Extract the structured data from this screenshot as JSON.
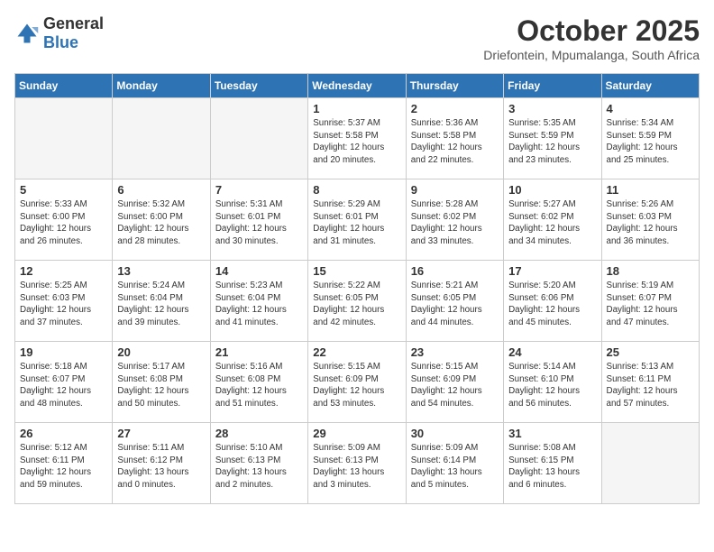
{
  "logo": {
    "general": "General",
    "blue": "Blue"
  },
  "header": {
    "month": "October 2025",
    "location": "Driefontein, Mpumalanga, South Africa"
  },
  "weekdays": [
    "Sunday",
    "Monday",
    "Tuesday",
    "Wednesday",
    "Thursday",
    "Friday",
    "Saturday"
  ],
  "weeks": [
    [
      {
        "day": "",
        "info": ""
      },
      {
        "day": "",
        "info": ""
      },
      {
        "day": "",
        "info": ""
      },
      {
        "day": "1",
        "info": "Sunrise: 5:37 AM\nSunset: 5:58 PM\nDaylight: 12 hours and 20 minutes."
      },
      {
        "day": "2",
        "info": "Sunrise: 5:36 AM\nSunset: 5:58 PM\nDaylight: 12 hours and 22 minutes."
      },
      {
        "day": "3",
        "info": "Sunrise: 5:35 AM\nSunset: 5:59 PM\nDaylight: 12 hours and 23 minutes."
      },
      {
        "day": "4",
        "info": "Sunrise: 5:34 AM\nSunset: 5:59 PM\nDaylight: 12 hours and 25 minutes."
      }
    ],
    [
      {
        "day": "5",
        "info": "Sunrise: 5:33 AM\nSunset: 6:00 PM\nDaylight: 12 hours and 26 minutes."
      },
      {
        "day": "6",
        "info": "Sunrise: 5:32 AM\nSunset: 6:00 PM\nDaylight: 12 hours and 28 minutes."
      },
      {
        "day": "7",
        "info": "Sunrise: 5:31 AM\nSunset: 6:01 PM\nDaylight: 12 hours and 30 minutes."
      },
      {
        "day": "8",
        "info": "Sunrise: 5:29 AM\nSunset: 6:01 PM\nDaylight: 12 hours and 31 minutes."
      },
      {
        "day": "9",
        "info": "Sunrise: 5:28 AM\nSunset: 6:02 PM\nDaylight: 12 hours and 33 minutes."
      },
      {
        "day": "10",
        "info": "Sunrise: 5:27 AM\nSunset: 6:02 PM\nDaylight: 12 hours and 34 minutes."
      },
      {
        "day": "11",
        "info": "Sunrise: 5:26 AM\nSunset: 6:03 PM\nDaylight: 12 hours and 36 minutes."
      }
    ],
    [
      {
        "day": "12",
        "info": "Sunrise: 5:25 AM\nSunset: 6:03 PM\nDaylight: 12 hours and 37 minutes."
      },
      {
        "day": "13",
        "info": "Sunrise: 5:24 AM\nSunset: 6:04 PM\nDaylight: 12 hours and 39 minutes."
      },
      {
        "day": "14",
        "info": "Sunrise: 5:23 AM\nSunset: 6:04 PM\nDaylight: 12 hours and 41 minutes."
      },
      {
        "day": "15",
        "info": "Sunrise: 5:22 AM\nSunset: 6:05 PM\nDaylight: 12 hours and 42 minutes."
      },
      {
        "day": "16",
        "info": "Sunrise: 5:21 AM\nSunset: 6:05 PM\nDaylight: 12 hours and 44 minutes."
      },
      {
        "day": "17",
        "info": "Sunrise: 5:20 AM\nSunset: 6:06 PM\nDaylight: 12 hours and 45 minutes."
      },
      {
        "day": "18",
        "info": "Sunrise: 5:19 AM\nSunset: 6:07 PM\nDaylight: 12 hours and 47 minutes."
      }
    ],
    [
      {
        "day": "19",
        "info": "Sunrise: 5:18 AM\nSunset: 6:07 PM\nDaylight: 12 hours and 48 minutes."
      },
      {
        "day": "20",
        "info": "Sunrise: 5:17 AM\nSunset: 6:08 PM\nDaylight: 12 hours and 50 minutes."
      },
      {
        "day": "21",
        "info": "Sunrise: 5:16 AM\nSunset: 6:08 PM\nDaylight: 12 hours and 51 minutes."
      },
      {
        "day": "22",
        "info": "Sunrise: 5:15 AM\nSunset: 6:09 PM\nDaylight: 12 hours and 53 minutes."
      },
      {
        "day": "23",
        "info": "Sunrise: 5:15 AM\nSunset: 6:09 PM\nDaylight: 12 hours and 54 minutes."
      },
      {
        "day": "24",
        "info": "Sunrise: 5:14 AM\nSunset: 6:10 PM\nDaylight: 12 hours and 56 minutes."
      },
      {
        "day": "25",
        "info": "Sunrise: 5:13 AM\nSunset: 6:11 PM\nDaylight: 12 hours and 57 minutes."
      }
    ],
    [
      {
        "day": "26",
        "info": "Sunrise: 5:12 AM\nSunset: 6:11 PM\nDaylight: 12 hours and 59 minutes."
      },
      {
        "day": "27",
        "info": "Sunrise: 5:11 AM\nSunset: 6:12 PM\nDaylight: 13 hours and 0 minutes."
      },
      {
        "day": "28",
        "info": "Sunrise: 5:10 AM\nSunset: 6:13 PM\nDaylight: 13 hours and 2 minutes."
      },
      {
        "day": "29",
        "info": "Sunrise: 5:09 AM\nSunset: 6:13 PM\nDaylight: 13 hours and 3 minutes."
      },
      {
        "day": "30",
        "info": "Sunrise: 5:09 AM\nSunset: 6:14 PM\nDaylight: 13 hours and 5 minutes."
      },
      {
        "day": "31",
        "info": "Sunrise: 5:08 AM\nSunset: 6:15 PM\nDaylight: 13 hours and 6 minutes."
      },
      {
        "day": "",
        "info": ""
      }
    ]
  ]
}
